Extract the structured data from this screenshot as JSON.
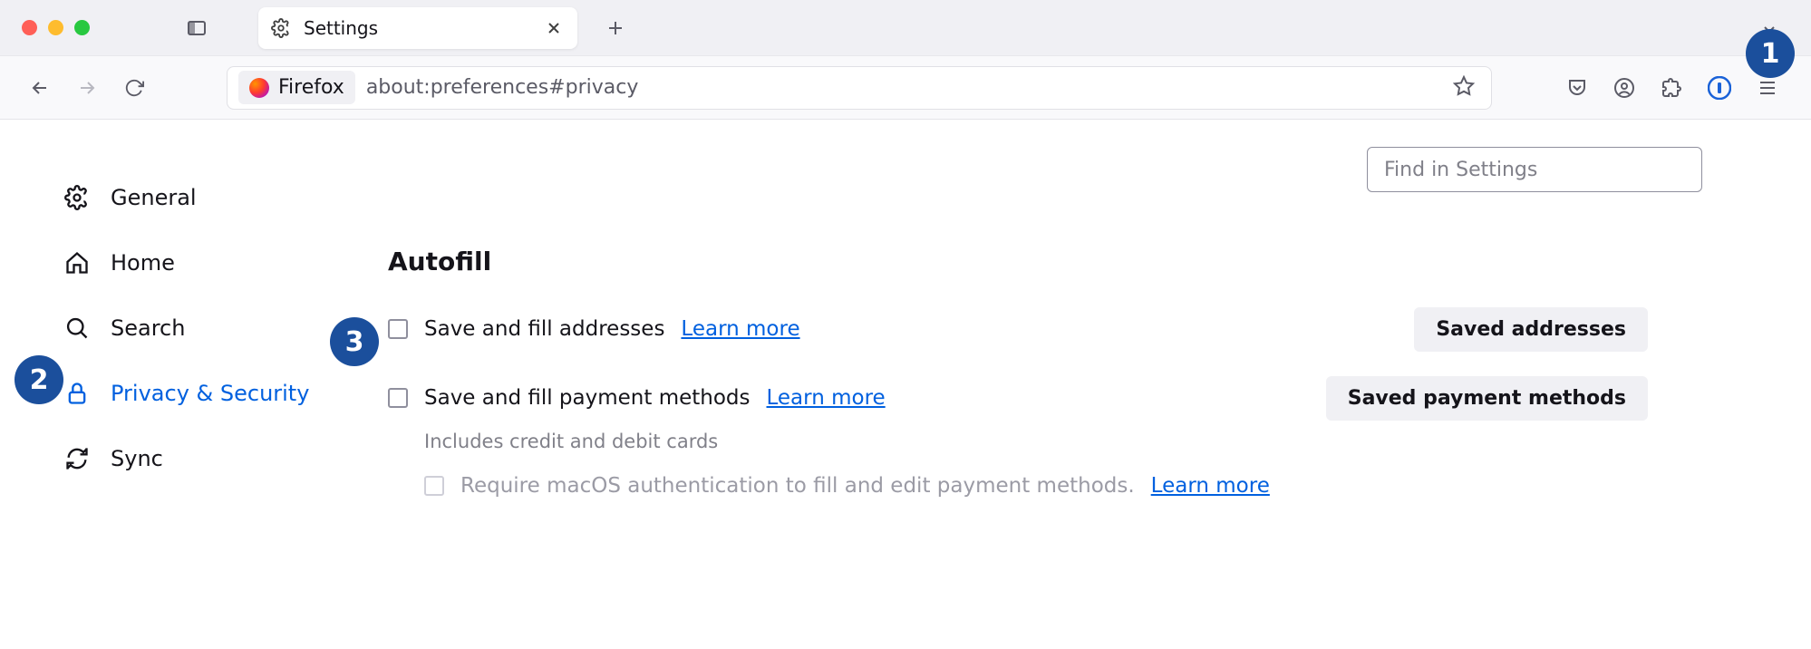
{
  "callouts": [
    "1",
    "2",
    "3"
  ],
  "tab": {
    "title": "Settings"
  },
  "urlbar": {
    "identity_label": "Firefox",
    "url": "about:preferences#privacy"
  },
  "search_settings": {
    "placeholder": "Find in Settings"
  },
  "sidebar": {
    "items": [
      {
        "label": "General"
      },
      {
        "label": "Home"
      },
      {
        "label": "Search"
      },
      {
        "label": "Privacy & Security"
      },
      {
        "label": "Sync"
      }
    ]
  },
  "main": {
    "section_heading": "Autofill",
    "addresses": {
      "label": "Save and fill addresses",
      "learn_more": "Learn more",
      "button": "Saved addresses"
    },
    "payments": {
      "label": "Save and fill payment methods",
      "learn_more": "Learn more",
      "button": "Saved payment methods",
      "help": "Includes credit and debit cards",
      "require_auth": "Require macOS authentication to fill and edit payment methods.",
      "require_auth_learn_more": "Learn more"
    }
  }
}
